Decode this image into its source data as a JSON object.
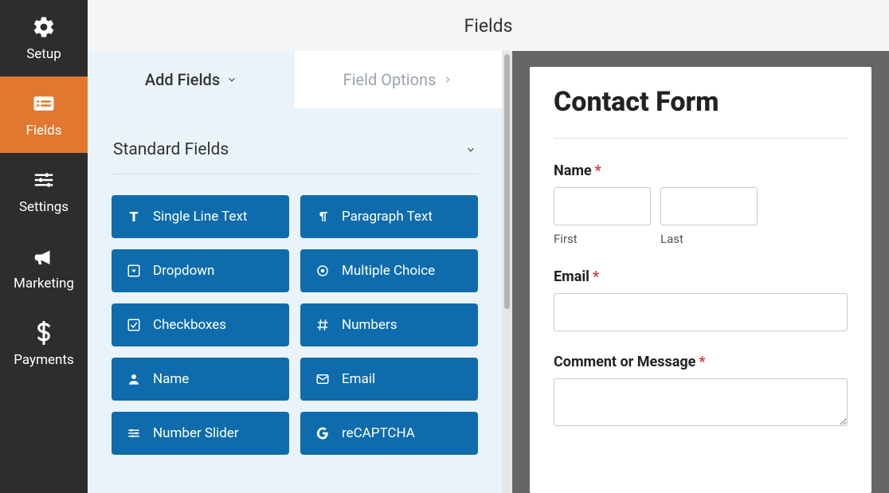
{
  "sidebar": {
    "items": [
      {
        "label": "Setup"
      },
      {
        "label": "Fields"
      },
      {
        "label": "Settings"
      },
      {
        "label": "Marketing"
      },
      {
        "label": "Payments"
      }
    ]
  },
  "topbar": {
    "title": "Fields"
  },
  "panel": {
    "tabs": {
      "add": "Add Fields",
      "options": "Field Options"
    },
    "section_title": "Standard Fields",
    "fields": [
      {
        "label": "Single Line Text",
        "icon": "text"
      },
      {
        "label": "Paragraph Text",
        "icon": "paragraph"
      },
      {
        "label": "Dropdown",
        "icon": "dropdown"
      },
      {
        "label": "Multiple Choice",
        "icon": "radio"
      },
      {
        "label": "Checkboxes",
        "icon": "check"
      },
      {
        "label": "Numbers",
        "icon": "hash"
      },
      {
        "label": "Name",
        "icon": "user"
      },
      {
        "label": "Email",
        "icon": "mail"
      },
      {
        "label": "Number Slider",
        "icon": "sliders"
      },
      {
        "label": "reCAPTCHA",
        "icon": "google"
      }
    ]
  },
  "preview": {
    "form_title": "Contact Form",
    "name": {
      "label": "Name",
      "first": "First",
      "last": "Last"
    },
    "email": {
      "label": "Email"
    },
    "comment": {
      "label": "Comment or Message"
    }
  }
}
